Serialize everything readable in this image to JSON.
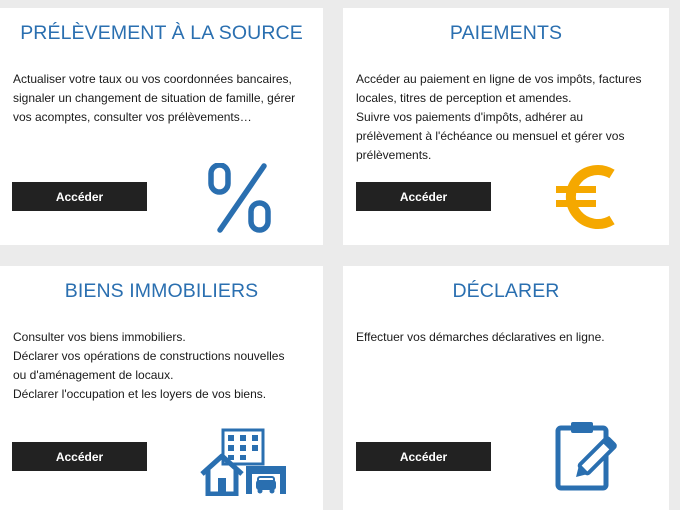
{
  "colors": {
    "title": "#2a6fb0",
    "icon_blue": "#2a6fb0",
    "icon_gold": "#f5a800",
    "button": "#222222"
  },
  "cards": [
    {
      "title": "PRÉLÈVEMENT À LA SOURCE",
      "lines": [
        "Actualiser votre taux ou vos coordonnées bancaires,",
        "signaler un changement de situation de famille, gérer",
        "vos acomptes, consulter vos prélèvements…"
      ],
      "button": "Accéder",
      "icon": "percent-icon"
    },
    {
      "title": "PAIEMENTS",
      "lines": [
        "Accéder au paiement en ligne de vos impôts, factures",
        "locales, titres de perception et amendes.",
        "Suivre vos paiements d'impôts, adhérer au",
        "prélèvement à l'échéance ou mensuel et gérer vos",
        "prélèvements."
      ],
      "button": "Accéder",
      "icon": "euro-icon"
    },
    {
      "title": "BIENS IMMOBILIERS",
      "lines": [
        "Consulter vos biens immobiliers.",
        "Déclarer vos opérations de constructions nouvelles",
        "ou d'aménagement de locaux.",
        "Déclarer l'occupation et les loyers de vos biens."
      ],
      "button": "Accéder",
      "icon": "buildings-icon"
    },
    {
      "title": "DÉCLARER",
      "lines": [
        "Effectuer vos démarches déclaratives en ligne."
      ],
      "button": "Accéder",
      "icon": "clipboard-pen-icon"
    }
  ]
}
